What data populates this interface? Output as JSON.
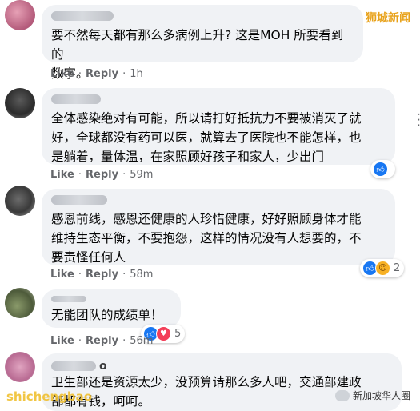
{
  "watermarks": {
    "top_right": "狮城新闻",
    "bottom_left": "shichengbao",
    "bottom_right": "新加坡华人圈"
  },
  "common": {
    "like": "Like",
    "reply": "Reply",
    "sep": "·"
  },
  "comments": [
    {
      "name": "",
      "text": "要不然每天都有那么多病例上升? 这是MOH 所要看到的\n数字。",
      "time": "1h",
      "reactions": [],
      "reaction_count": ""
    },
    {
      "name": "",
      "text": "全体感染绝对有可能，所以请打好抵抗力不要被消灭了就\n好，全球都没有药可以医，就算去了医院也不能怎样，也\n是躺着，量体温，在家照顾好孩子和家人，少出门",
      "time": "59m",
      "reactions": [
        "like"
      ],
      "reaction_count": ""
    },
    {
      "name": "",
      "text": "感恩前线，感恩还健康的人珍惜健康，好好照顾身体才能\n维持生态平衡，不要抱怨，这样的情况没有人想要的，不\n要责怪任何人",
      "time": "58m",
      "reactions": [
        "like",
        "haha"
      ],
      "reaction_count": "2"
    },
    {
      "name": "",
      "text": "无能团队的成绩单！",
      "time": "56m",
      "reactions": [
        "like",
        "love"
      ],
      "reaction_count": "5"
    },
    {
      "name": "o",
      "text": "卫生部还是资源太少，没预算请那么多人吧，交通部建政\n部都有钱，呵呵。",
      "time": "",
      "reactions": [],
      "reaction_count": ""
    }
  ]
}
